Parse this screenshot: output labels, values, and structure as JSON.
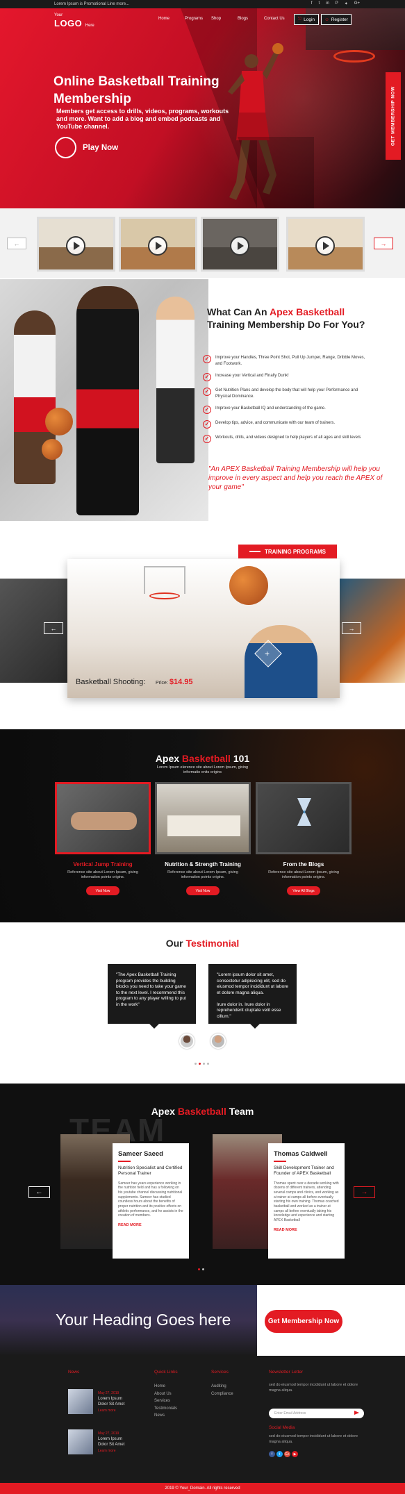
{
  "topbar": {
    "promo": "Lorem Ipsum is Promotional Line more...",
    "social": [
      "f",
      "t",
      "in",
      "P",
      "✦",
      "G+"
    ]
  },
  "header": {
    "logo_small": "Your",
    "logo_big": "LOGO",
    "logo_here": "Here",
    "nav": [
      "Home",
      "Programs",
      "Shop",
      "Blogs",
      "Contact Us"
    ],
    "login": "Login",
    "register": "Register"
  },
  "hero": {
    "title": "Online Basketball Training Membership",
    "desc": "Members get access to drills, videos, programs, workouts and more. Want to add a blog and embed podcasts and YouTube channel.",
    "play": "Play Now",
    "side_tab": "GET MEMBERSHIP NOW"
  },
  "what": {
    "title_pre": "What Can An ",
    "title_red": "Apex Basketball",
    "title_post": " Training Membership Do For You?",
    "items": [
      "Improve your Handles, Three Point Shot, Pull Up Jumper, Range, Dribble Moves, and Footwork.",
      "Increase your Vertical and Finally Dunk!",
      "Get Nutrition Plans and develop the body that will help your Performance and Physical Dominance.",
      "Improve your Basketball IQ and understanding of the game.",
      "Develop tips, advice, and communicate with our team of trainers.",
      "Workouts, drills, and videos designed to help players of all ages and skill levels"
    ],
    "quote": "\"An APEX Basketball Training Membership will help you improve in every aspect and help you reach the APEX of your game\""
  },
  "training": {
    "label": "TRAINING PROGRAMS",
    "caption": "Basketball Shooting:",
    "price_label": "Price:",
    "price": "$14.95"
  },
  "b101": {
    "title_pre": "Apex ",
    "title_red": "Basketball",
    "title_post": " 101",
    "sub": "Lorem Ipsum elerence site about Lorem Ipsum, giving informatio onits origins",
    "cards": [
      {
        "title": "Vertical Jump Training",
        "desc": "Reference site about Lorem Ipsum, giving information points origins.",
        "btn": "Visit Now"
      },
      {
        "title": "Nutrition & Strength Training",
        "desc": "Reference site about Lorem Ipsum, giving information points origins.",
        "btn": "Visit Now"
      },
      {
        "title": "From the Blogs",
        "desc": "Reference site about Lorem Ipsum, giving information points origins.",
        "btn": "View All Blogs"
      }
    ]
  },
  "testimonial": {
    "title_pre": "Our ",
    "title_red": "Testimonial",
    "t1": "\"The Apex Basketball Training program provides the building blocks you need to take your game to the next level. I recommend this program to any player willing to put in the work\"",
    "t2_a": "\"Lorem ipsum dolor sit amet, consectetur adipisicing elit, sed do eiusmod tempor incididunt ut labore et dolore magna aliqua.",
    "t2_b": "Irure dolor in. Irure dolor in reprehenderit oluptate velit esse cillum.\""
  },
  "team": {
    "title_pre": "Apex ",
    "title_red": "Basketball",
    "title_post": " Team",
    "bg_word": "TEAM",
    "members": [
      {
        "name": "Sameer Saeed",
        "role": "Nutrition Specialist and Certified Personal Trainer",
        "bio": "Sameer has years experience working in the nutrition field and has a following on his youtube channel discussing nutritional supplements. Sameer has studied countless hours about the benefits of proper nutrition and its positive effects on athletic performance, and he assists in the creation of members.",
        "more": "READ MORE"
      },
      {
        "name": "Thomas Caldwell",
        "role": "Skill Development Trainer and Founder of APEX Basketball",
        "bio": "Thomas spent over a decade working with dozens of different trainers, attending several camps and clinics, and working as a trainer at camps all before eventually starting his own training. Thomas coached basketball and worked as a trainer at camps all before eventually taking his knowledge and experience and starting APEX Basketball",
        "more": "READ MORE"
      }
    ]
  },
  "cta": {
    "heading": "Your Heading Goes here",
    "button": "Get Membership Now"
  },
  "footer": {
    "news_h": "News",
    "news": [
      {
        "date": "May 27, 2019",
        "title": "Lorem Ipsum Dolor Sit Amet",
        "more": "Learn more"
      },
      {
        "date": "May 27, 2019",
        "title": "Lorem Ipsum Dolor Sit Amet",
        "more": "Learn more"
      }
    ],
    "quick_h": "Quick Links",
    "quick": [
      "Home",
      "About Us",
      "Services",
      "Testimonials",
      "News"
    ],
    "services_h": "Services",
    "services": [
      "Auditing",
      "Compliance"
    ],
    "newsletter_h": "Newsletter Letter",
    "newsletter_text": "sed do eiusmod tempor incididunt ut labore et dolore magna aliqua.",
    "email_placeholder": "Enter Email Address",
    "social_h": "Social Media",
    "social_text": "sed do eiusmod tempor incididunt ut labore et dolore magna aliqua.",
    "copyright": "2019 © Your_Domain. All rights reserved"
  },
  "colors": {
    "accent": "#e31b23",
    "dark": "#1a1a1a"
  }
}
